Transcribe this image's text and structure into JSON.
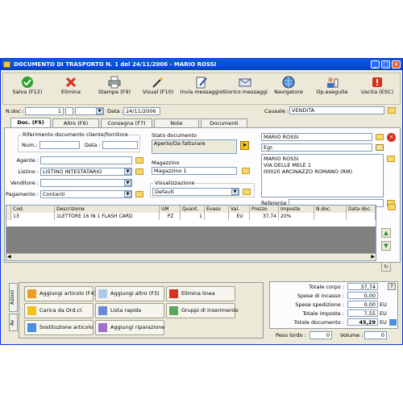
{
  "window": {
    "title": "DOCUMENTO DI TRASPORTO N. 1  del 24/11/2006  - MARIO ROSSI"
  },
  "toolbar": [
    {
      "label": "Salva (F12)",
      "icon": "check-icon"
    },
    {
      "label": "Elimina",
      "icon": "x-icon"
    },
    {
      "label": "Stampa (F9)",
      "icon": "printer-icon"
    },
    {
      "label": "Visual (F10)",
      "icon": "magic-wand-icon"
    },
    {
      "label": "Invia messaggio",
      "icon": "pen-document-icon"
    },
    {
      "label": "Storico messaggi",
      "icon": "envelope-icon"
    },
    {
      "label": "Navigatore",
      "icon": "globe-icon"
    },
    {
      "label": "Op.eseguite",
      "icon": "user-list-icon"
    },
    {
      "label": "Uscita (ESC)",
      "icon": "exit-icon"
    }
  ],
  "header": {
    "ndoc_label": "N.doc :",
    "ndoc_value": "1",
    "data_label": "Data :",
    "data_value": "24/11/2006",
    "causale_label": "Causale :",
    "causale_value": "VENDITA"
  },
  "tabs": [
    "Doc. (F5)",
    "Altro (F6)",
    "Consegna (F7)",
    "Note",
    "Documenti"
  ],
  "doc": {
    "rif_title": "Riferimento documento cliente/fornitore",
    "num_label": "Num.:",
    "num_value": "",
    "data_label": "Data :",
    "data_value": "",
    "stato_title": "Stato documento",
    "stato_value": "Aperto/Da fatturare",
    "agente_label": "Agente :",
    "agente_value": "",
    "listino_label": "Listino :",
    "listino_value": "LISTINO INTESTATARIO",
    "venditore_label": "Venditore :",
    "venditore_value": "",
    "pagamento_label": "Pagamento :",
    "pagamento_value": "Contanti",
    "magazzino_title": "Magazzino",
    "magazzino_value": "Magazzino 1",
    "visual_title": "Visualizzazione",
    "visual_value": "Default",
    "cliente_name": "MARIO ROSSI",
    "egr": "Egr.",
    "addr_line1": "MARIO ROSSI",
    "addr_line2": "VIA DELLE MELE 1",
    "addr_line3": "00020 ARCINAZZO ROMANO (RM)",
    "referente_label": "Referente",
    "referente_value": ""
  },
  "grid": {
    "columns": [
      "Cod.",
      "Descrizione",
      "UM",
      "Quant.",
      "Evaso",
      "Val.",
      "Prezzo",
      "Imposte",
      "N.doc.",
      "Data doc."
    ],
    "rows": [
      [
        "13",
        "1LETTORE 16 IN 1 FLASH CARD",
        "PZ",
        "1",
        "",
        "EU",
        "37,74",
        "20%",
        "",
        ""
      ]
    ]
  },
  "actions": {
    "vtab1": "Azioni",
    "vtab2": "Av",
    "buttons": [
      "Aggiungi articolo (F4)",
      "Aggiungi altro (F3)",
      "Elimina linea",
      "Carica da Ord.cl.",
      "Lista rapida",
      "Gruppi di inserimento",
      "Sostituzione articolo",
      "Aggiungi riparazione"
    ]
  },
  "totals": {
    "rows": [
      {
        "label": "Totale corpo :",
        "value": "37,74",
        "unit": ""
      },
      {
        "label": "Spese di incasso :",
        "value": "0,00",
        "unit": ""
      },
      {
        "label": "Spese spedizione :",
        "value": "0,00",
        "unit": "EU"
      },
      {
        "label": "Totale imposte :",
        "value": "7,55",
        "unit": "EU"
      },
      {
        "label": "Totale documento :",
        "value": "45,29",
        "unit": "EU"
      }
    ],
    "help": "?",
    "peso_label": "Peso lordo :",
    "peso_value": "0",
    "volume_label": "Volume :",
    "volume_value": "0"
  }
}
